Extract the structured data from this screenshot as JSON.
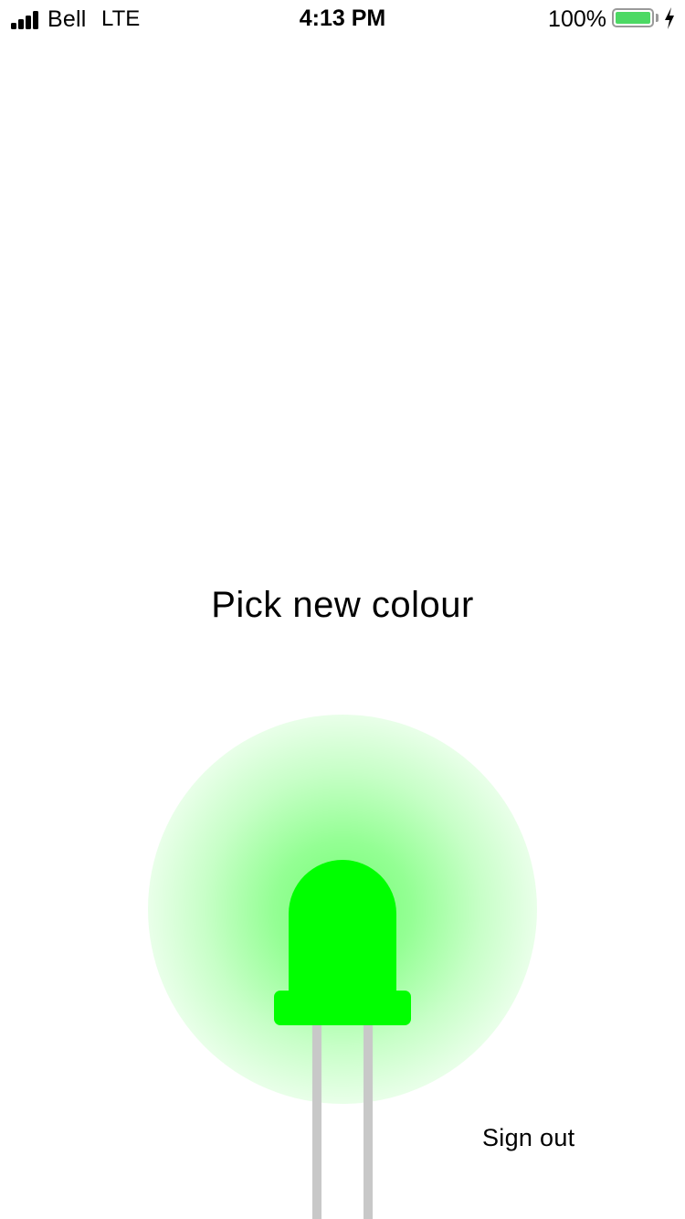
{
  "status_bar": {
    "carrier": "Bell",
    "network": "LTE",
    "time": "4:13 PM",
    "battery_percent": "100%"
  },
  "main": {
    "pick_colour_label": "Pick new colour",
    "led_colour": "#00ff00",
    "sign_out_label": "Sign out"
  },
  "icons": {
    "signal": "signal-bars-icon",
    "battery": "battery-full-icon",
    "charging": "charging-bolt-icon",
    "led": "led-bulb-icon"
  },
  "colors": {
    "battery_fill": "#4cd964",
    "led_leg": "#c8c8c8"
  }
}
